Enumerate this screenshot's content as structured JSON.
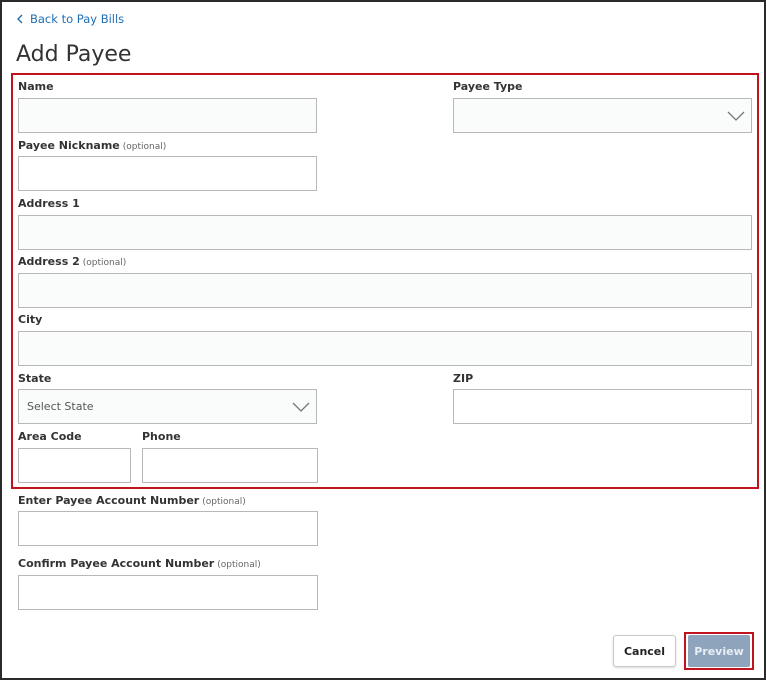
{
  "nav": {
    "back_label": "Back to Pay Bills"
  },
  "page": {
    "title": "Add Payee"
  },
  "form": {
    "optional_tag": "(optional)",
    "name_label": "Name",
    "payee_type_label": "Payee Type",
    "nickname_label": "Payee Nickname",
    "address1_label": "Address 1",
    "address2_label": "Address 2",
    "city_label": "City",
    "state_label": "State",
    "state_placeholder": "Select State",
    "zip_label": "ZIP",
    "area_code_label": "Area Code",
    "phone_label": "Phone",
    "account_label": "Enter Payee Account Number",
    "confirm_account_label": "Confirm Payee Account Number"
  },
  "actions": {
    "cancel_label": "Cancel",
    "preview_label": "Preview"
  },
  "colors": {
    "link": "#1f6fb5",
    "highlight": "#c1121f",
    "preview_bg": "#8ea4bc"
  },
  "icons": {
    "back": "chevron-left-icon",
    "dropdown": "chevron-down-icon"
  }
}
